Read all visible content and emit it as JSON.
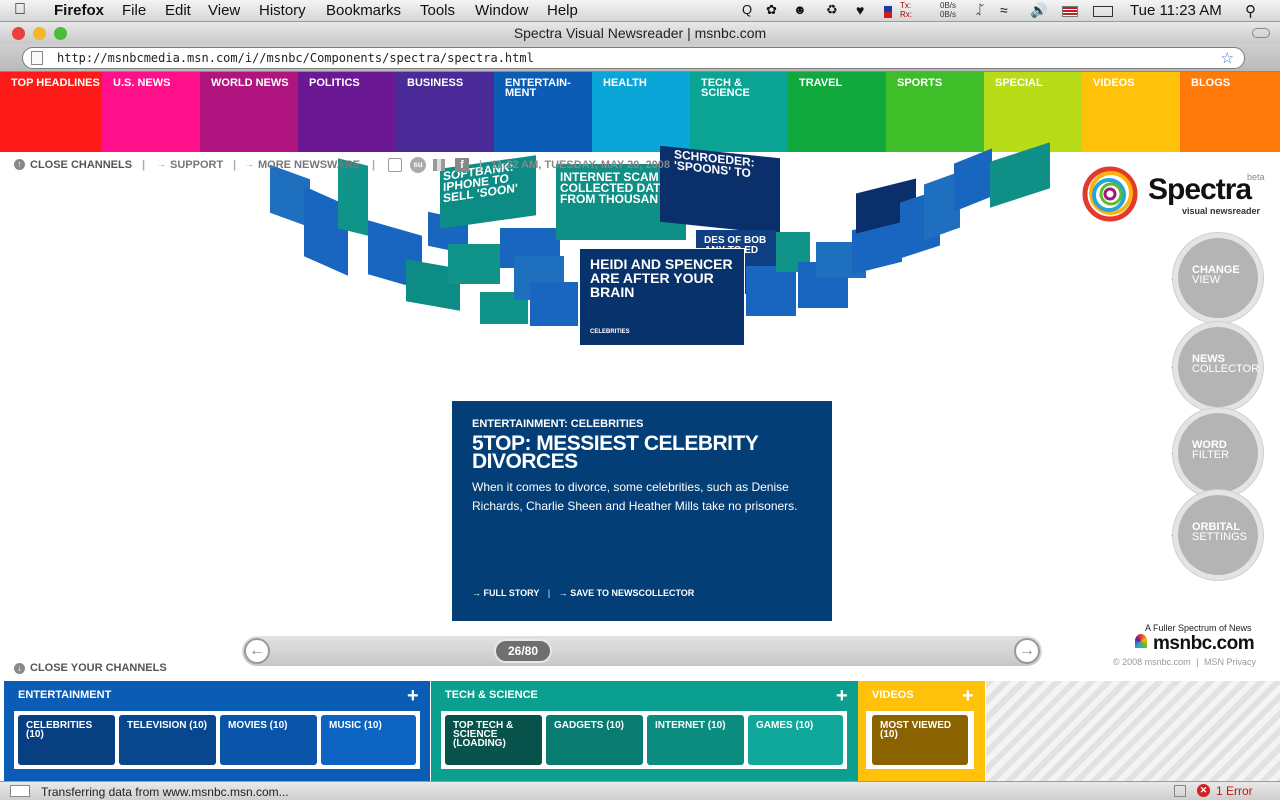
{
  "menubar": {
    "app": "Firefox",
    "items": [
      "File",
      "Edit",
      "View",
      "History",
      "Bookmarks",
      "Tools",
      "Window",
      "Help"
    ],
    "net_tx_label": "Tx:",
    "net_rx_label": "Rx:",
    "net_tx": "0B/s",
    "net_rx": "0B/s",
    "clock": "Tue 11:23 AM"
  },
  "window": {
    "title": "Spectra Visual Newsreader | msnbc.com"
  },
  "navbar": {
    "url": "http://msnbcmedia.msn.com/i//msnbc/Components/spectra/spectra.html"
  },
  "channels": [
    {
      "label": "TOP HEADLINES",
      "color": "#ff1a1a"
    },
    {
      "label": "U.S. NEWS",
      "color": "#ff0f8a"
    },
    {
      "label": "WORLD NEWS",
      "color": "#b0147e"
    },
    {
      "label": "POLITICS",
      "color": "#6a1894"
    },
    {
      "label": "BUSINESS",
      "color": "#4a2a96"
    },
    {
      "label": "ENTERTAIN-MENT",
      "color": "#0a5cb4"
    },
    {
      "label": "HEALTH",
      "color": "#0ba6d8"
    },
    {
      "label": "TECH & SCIENCE",
      "color": "#0aa394"
    },
    {
      "label": "TRAVEL",
      "color": "#11a83e"
    },
    {
      "label": "SPORTS",
      "color": "#3fbe2a"
    },
    {
      "label": "SPECIAL",
      "color": "#b9dc19"
    },
    {
      "label": "VIDEOS",
      "color": "#ffc10a"
    },
    {
      "label": "BLOGS",
      "color": "#ff7a0a"
    }
  ],
  "toolbar": {
    "close_channels": "CLOSE CHANNELS",
    "support": "SUPPORT",
    "more_newsware": "MORE NEWSWARE",
    "timestamp": "11:22 AM, TUESDAY, MAY 20, 2008"
  },
  "orbit": {
    "featured_headline": "HEIDI AND SPENCER ARE AFTER YOUR BRAIN",
    "featured_category": "CELEBRITIES",
    "back_headline_1": "INTERNET SCAM COLLECTED DATA FROM THOUSAN",
    "back_headline_2": "SCHROEDER: 'SPOONS' TO",
    "back_headline_3": "SOFTBANK: IPHONE TO SELL 'SOON'",
    "back_headline_4": "DES OF BOB ANY TO ED"
  },
  "logo": {
    "name": "Spectra",
    "beta": "beta",
    "tagline": "visual newsreader"
  },
  "controls": [
    {
      "line1": "CHANGE",
      "line2": "VIEW"
    },
    {
      "line1": "NEWS",
      "line2": "COLLECTOR"
    },
    {
      "line1": "WORD",
      "line2": "FILTER"
    },
    {
      "line1": "ORBITAL",
      "line2": "SETTINGS"
    }
  ],
  "story": {
    "kicker": "ENTERTAINMENT: CELEBRITIES",
    "headline": "5TOP: MESSIEST CELEBRITY DIVORCES",
    "summary": "When it comes to divorce, some celebrities, such as Denise Richards, Charlie Sheen and Heather Mills take no prisoners.",
    "full_story": "FULL STORY",
    "save": "SAVE TO NEWSCOLLECTOR"
  },
  "slider": {
    "counter": "26/80",
    "left": "←",
    "right": "→"
  },
  "branding": {
    "tagline": "A Fuller Spectrum of News",
    "name": "msnbc.com",
    "copyright": "© 2008 msnbc.com",
    "privacy": "MSN Privacy"
  },
  "close_your_channels": "CLOSE YOUR CHANNELS",
  "panels": [
    {
      "title": "ENTERTAINMENT",
      "color": "#0a5cb4",
      "items": [
        {
          "label": "CELEBRITIES (10)",
          "color": "#073f80"
        },
        {
          "label": "TELEVISION (10)",
          "color": "#08478e"
        },
        {
          "label": "MOVIES (10)",
          "color": "#0a55aa"
        },
        {
          "label": "MUSIC (10)",
          "color": "#0c63c2"
        }
      ]
    },
    {
      "title": "TECH & SCIENCE",
      "color": "#0a9f8e",
      "items": [
        {
          "label": "TOP TECH & SCIENCE (LOADING)",
          "color": "#07534c"
        },
        {
          "label": "GADGETS (10)",
          "color": "#0a7b70"
        },
        {
          "label": "INTERNET (10)",
          "color": "#0b8c7f"
        },
        {
          "label": "GAMES (10)",
          "color": "#10a89a"
        }
      ]
    },
    {
      "title": "VIDEOS",
      "color": "#ffc10a",
      "items": [
        {
          "label": "MOST VIEWED (10)",
          "color": "#8a6300"
        }
      ]
    }
  ],
  "status": {
    "text": "Transferring data from www.msnbc.msn.com...",
    "errors": "1 Error"
  }
}
